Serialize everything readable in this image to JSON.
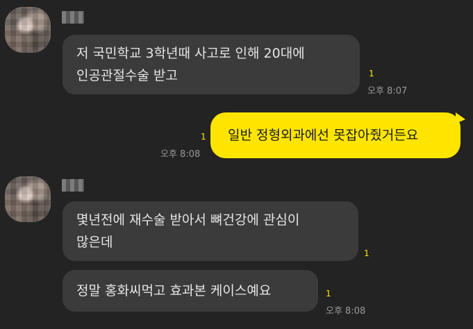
{
  "colors": {
    "background": "#232323",
    "received_bubble": "#3b3b3b",
    "sent_bubble": "#fee500",
    "unread": "#fee500",
    "timestamp": "#9a9a9a"
  },
  "messages": [
    {
      "direction": "received",
      "lines": [
        "저 국민학교 3학년때 사고로 인해 20대에",
        "인공관절수술 받고"
      ],
      "unread": "1",
      "time": "오후 8:07"
    },
    {
      "direction": "sent",
      "lines": [
        "일반 정형외과에선 못잡아줬거든요"
      ],
      "unread": "1",
      "time": "오후 8:08"
    },
    {
      "direction": "received",
      "lines": [
        "몇년전에 재수술 받아서 뼈건강에 관심이",
        "많은데"
      ],
      "unread": "1"
    },
    {
      "direction": "received",
      "lines": [
        "정말 홍화씨먹고 효과본 케이스예요"
      ],
      "unread": "1",
      "time": "오후 8:08"
    }
  ]
}
